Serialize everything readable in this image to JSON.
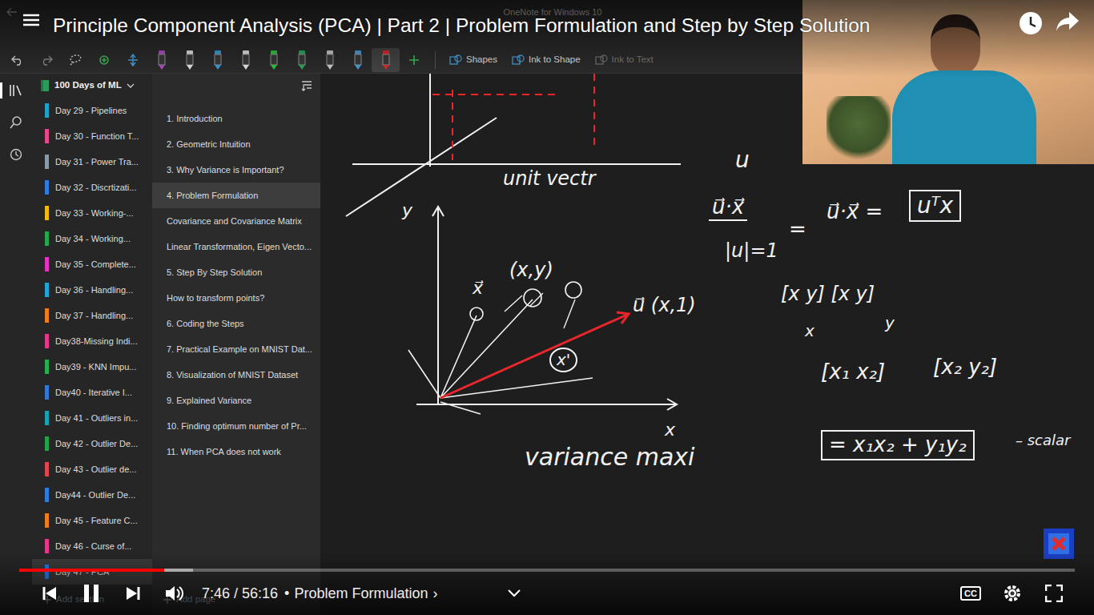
{
  "player": {
    "title": "Principle Component Analysis (PCA) | Part 2 | Problem Formulation and Step by Step Solution",
    "time": "7:46 / 56:16",
    "separator": "•",
    "chapter": "Problem Formulation",
    "chapter_arrow": "›",
    "playing": true,
    "progress": {
      "level": 0.137,
      "buffered": 0.165
    },
    "cc": "CC"
  },
  "app": {
    "title": "OneNote for Windows 10",
    "pens": [
      {
        "color": "#b04fc4",
        "selected": false
      },
      {
        "color": "#e8e8e8",
        "selected": false
      },
      {
        "color": "#3aa0e0",
        "selected": false
      },
      {
        "color": "#e8e8e8",
        "selected": false
      },
      {
        "color": "#2ecc40",
        "selected": false
      },
      {
        "color": "#27ae60",
        "selected": false
      },
      {
        "color": "#cfcfcf",
        "selected": false
      },
      {
        "color": "#4aa3df",
        "selected": false
      },
      {
        "color": "#e22b2b",
        "selected": true
      }
    ],
    "tools": [
      {
        "label": "Shapes",
        "disabled": false
      },
      {
        "label": "Ink to Shape",
        "disabled": false
      },
      {
        "label": "Ink to Text",
        "disabled": true
      }
    ],
    "notebook": "100 Days of ML",
    "sections": [
      {
        "label": "Day 29 - Pipelines",
        "color": "#1fa2c7",
        "selected": false
      },
      {
        "label": "Day 30 - Function T...",
        "color": "#e8488a",
        "selected": false
      },
      {
        "label": "Day 31 - Power Tra...",
        "color": "#8a9aa6",
        "selected": false
      },
      {
        "label": "Day 32 - Discrtizati...",
        "color": "#2b7de1",
        "selected": false
      },
      {
        "label": "Day 33 - Working-...",
        "color": "#f2b90f",
        "selected": false
      },
      {
        "label": "Day 34 - Working...",
        "color": "#22a94b",
        "selected": false
      },
      {
        "label": "Day 35 - Complete...",
        "color": "#e533c4",
        "selected": false
      },
      {
        "label": "Day 36 - Handling...",
        "color": "#1ea6d9",
        "selected": false
      },
      {
        "label": "Day 37 - Handling...",
        "color": "#f07b1d",
        "selected": false
      },
      {
        "label": "Day38-Missing Indi...",
        "color": "#e6378b",
        "selected": false
      },
      {
        "label": "Day39 - KNN Impu...",
        "color": "#21b24f",
        "selected": false
      },
      {
        "label": "Day40 - Iterative I...",
        "color": "#3577d4",
        "selected": false
      },
      {
        "label": "Day 41 - Outliers in...",
        "color": "#15a3b3",
        "selected": false
      },
      {
        "label": "Day 42 - Outlier De...",
        "color": "#21a34a",
        "selected": false
      },
      {
        "label": "Day 43 - Outlier de...",
        "color": "#e0464d",
        "selected": false
      },
      {
        "label": "Day44 - Outlier De...",
        "color": "#2b7de1",
        "selected": false
      },
      {
        "label": "Day 45 - Feature C...",
        "color": "#f07b1d",
        "selected": false
      },
      {
        "label": "Day 46 - Curse of...",
        "color": "#e6378b",
        "selected": false
      },
      {
        "label": "Day 47 - PCA",
        "color": "#2b7de1",
        "selected": true
      }
    ],
    "pages": [
      {
        "label": "1. Introduction",
        "selected": false
      },
      {
        "label": "2. Geometric Intuition",
        "selected": false
      },
      {
        "label": "3. Why Variance is Important?",
        "selected": false
      },
      {
        "label": "4. Problem Formulation",
        "selected": true
      },
      {
        "label": "Covariance and Covariance Matrix",
        "selected": false
      },
      {
        "label": "Linear Transformation, Eigen Vecto...",
        "selected": false
      },
      {
        "label": "5. Step By Step Solution",
        "selected": false
      },
      {
        "label": "How to transform points?",
        "selected": false
      },
      {
        "label": "6. Coding the Steps",
        "selected": false
      },
      {
        "label": "7. Practical Example on MNIST Dat...",
        "selected": false
      },
      {
        "label": "8. Visualization of MNIST Dataset",
        "selected": false
      },
      {
        "label": "9. Explained Variance",
        "selected": false
      },
      {
        "label": "10. Finding optimum number of Pr...",
        "selected": false
      },
      {
        "label": "11. When PCA does not work",
        "selected": false
      }
    ],
    "add_section": "Add section",
    "add_page": "Add page"
  },
  "ink": [
    {
      "text": "unit vectr",
      "kind": "word"
    },
    {
      "text": "u",
      "kind": "word"
    },
    {
      "text": "y",
      "kind": "word"
    },
    {
      "text": "(x,y)",
      "kind": "word"
    },
    {
      "text": "x⃗",
      "kind": "word"
    },
    {
      "text": "u⃗ (x,1)",
      "kind": "word"
    },
    {
      "text": "x'",
      "kind": "circled"
    },
    {
      "text": "x",
      "kind": "word"
    },
    {
      "text": "variance maxi",
      "kind": "word"
    },
    {
      "text": "u⃗·x⃗",
      "kind": "fraction"
    },
    {
      "text": "|u|=1",
      "kind": "word"
    },
    {
      "text": "=",
      "kind": "word"
    },
    {
      "text": "u⃗·x⃗ =",
      "kind": "word"
    },
    {
      "text": "uᵀx",
      "kind": "boxed"
    },
    {
      "text": "[x y]  [x y]",
      "kind": "word"
    },
    {
      "text": "x",
      "kind": "word"
    },
    {
      "text": "y",
      "kind": "word"
    },
    {
      "text": "[x₁ x₂]",
      "kind": "word"
    },
    {
      "text": "[x₂ y₂]",
      "kind": "word"
    },
    {
      "text": "= x₁x₂ + y₁y₂",
      "kind": "boxed"
    },
    {
      "text": "– scalar",
      "kind": "word"
    }
  ]
}
